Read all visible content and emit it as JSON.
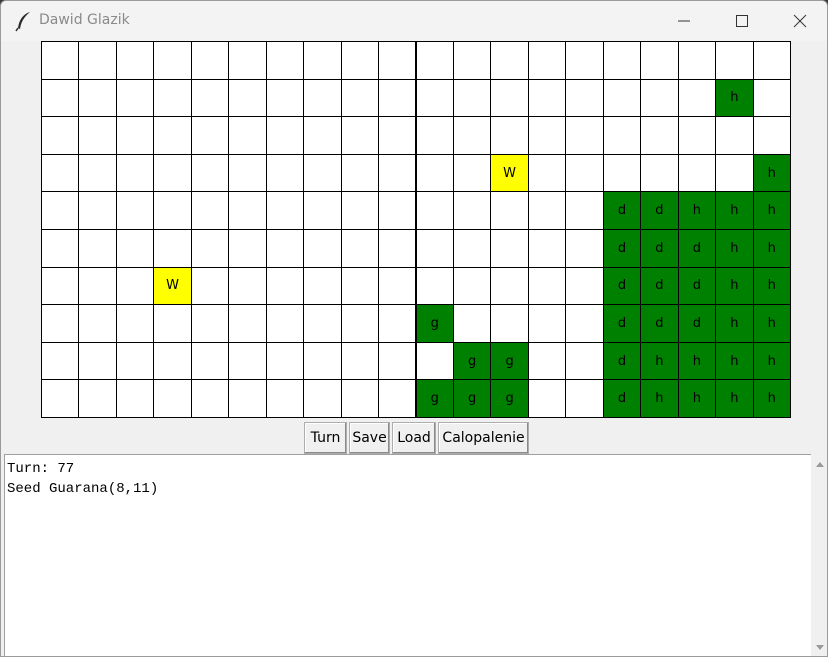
{
  "window": {
    "title": "Dawid Glazik",
    "icon": "feather-icon",
    "controls": [
      "minimize-icon",
      "maximize-icon",
      "close-icon"
    ]
  },
  "board": {
    "columns": 20,
    "rows": 10,
    "cells": [
      {
        "row": 1,
        "col": 18,
        "label": "h",
        "color": "#008000"
      },
      {
        "row": 3,
        "col": 12,
        "label": "W",
        "color": "#ffff00"
      },
      {
        "row": 3,
        "col": 19,
        "label": "h",
        "color": "#008000"
      },
      {
        "row": 4,
        "col": 15,
        "label": "d",
        "color": "#008000"
      },
      {
        "row": 4,
        "col": 16,
        "label": "d",
        "color": "#008000"
      },
      {
        "row": 4,
        "col": 17,
        "label": "h",
        "color": "#008000"
      },
      {
        "row": 4,
        "col": 18,
        "label": "h",
        "color": "#008000"
      },
      {
        "row": 4,
        "col": 19,
        "label": "h",
        "color": "#008000"
      },
      {
        "row": 5,
        "col": 15,
        "label": "d",
        "color": "#008000"
      },
      {
        "row": 5,
        "col": 16,
        "label": "d",
        "color": "#008000"
      },
      {
        "row": 5,
        "col": 17,
        "label": "d",
        "color": "#008000"
      },
      {
        "row": 5,
        "col": 18,
        "label": "h",
        "color": "#008000"
      },
      {
        "row": 5,
        "col": 19,
        "label": "h",
        "color": "#008000"
      },
      {
        "row": 6,
        "col": 3,
        "label": "W",
        "color": "#ffff00"
      },
      {
        "row": 6,
        "col": 15,
        "label": "d",
        "color": "#008000"
      },
      {
        "row": 6,
        "col": 16,
        "label": "d",
        "color": "#008000"
      },
      {
        "row": 6,
        "col": 17,
        "label": "d",
        "color": "#008000"
      },
      {
        "row": 6,
        "col": 18,
        "label": "h",
        "color": "#008000"
      },
      {
        "row": 6,
        "col": 19,
        "label": "h",
        "color": "#008000"
      },
      {
        "row": 7,
        "col": 10,
        "label": "g",
        "color": "#008000"
      },
      {
        "row": 7,
        "col": 15,
        "label": "d",
        "color": "#008000"
      },
      {
        "row": 7,
        "col": 16,
        "label": "d",
        "color": "#008000"
      },
      {
        "row": 7,
        "col": 17,
        "label": "d",
        "color": "#008000"
      },
      {
        "row": 7,
        "col": 18,
        "label": "h",
        "color": "#008000"
      },
      {
        "row": 7,
        "col": 19,
        "label": "h",
        "color": "#008000"
      },
      {
        "row": 8,
        "col": 11,
        "label": "g",
        "color": "#008000"
      },
      {
        "row": 8,
        "col": 12,
        "label": "g",
        "color": "#008000"
      },
      {
        "row": 8,
        "col": 15,
        "label": "d",
        "color": "#008000"
      },
      {
        "row": 8,
        "col": 16,
        "label": "h",
        "color": "#008000"
      },
      {
        "row": 8,
        "col": 17,
        "label": "h",
        "color": "#008000"
      },
      {
        "row": 8,
        "col": 18,
        "label": "h",
        "color": "#008000"
      },
      {
        "row": 8,
        "col": 19,
        "label": "h",
        "color": "#008000"
      },
      {
        "row": 9,
        "col": 10,
        "label": "g",
        "color": "#008000"
      },
      {
        "row": 9,
        "col": 11,
        "label": "g",
        "color": "#008000"
      },
      {
        "row": 9,
        "col": 12,
        "label": "g",
        "color": "#008000"
      },
      {
        "row": 9,
        "col": 15,
        "label": "d",
        "color": "#008000"
      },
      {
        "row": 9,
        "col": 16,
        "label": "h",
        "color": "#008000"
      },
      {
        "row": 9,
        "col": 17,
        "label": "h",
        "color": "#008000"
      },
      {
        "row": 9,
        "col": 18,
        "label": "h",
        "color": "#008000"
      },
      {
        "row": 9,
        "col": 19,
        "label": "h",
        "color": "#008000"
      }
    ]
  },
  "buttons": {
    "turn": "Turn",
    "save": "Save",
    "load": "Load",
    "calopalenie": "Calopalenie"
  },
  "log": {
    "lines": [
      "Turn: 77",
      "Seed Guarana(8,11)"
    ]
  }
}
